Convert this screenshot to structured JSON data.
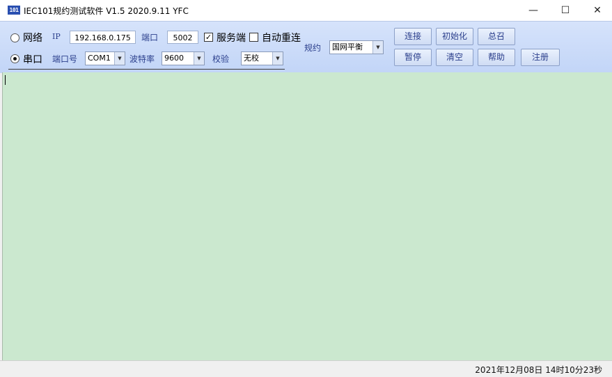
{
  "window": {
    "title": "IEC101规约测试软件  V1.5 2020.9.11   YFC",
    "icon_text": "101",
    "minimize": "—",
    "maximize": "☐",
    "close": "✕"
  },
  "network": {
    "radio_label": "网络",
    "ip_label": "IP",
    "ip_value": "192.168.0.175",
    "port_label": "端口",
    "port_value": "5002",
    "server_checked": true,
    "server_label": "服务端",
    "reconnect_checked": false,
    "reconnect_label": "自动重连"
  },
  "serial": {
    "radio_label": "串口",
    "com_label": "端口号",
    "com_value": "COM1",
    "baud_label": "波特率",
    "baud_value": "9600",
    "parity_label": "校验",
    "parity_value": "无校"
  },
  "protocol": {
    "label": "规约",
    "value": "国网平衡"
  },
  "buttons": {
    "connect": "连接",
    "init": "初始化",
    "general_call": "总召",
    "pause": "暂停",
    "clear": "清空",
    "help": "帮助",
    "register": "注册"
  },
  "status": {
    "datetime": "2021年12月08日   14时10分23秒"
  },
  "selected_mode": "serial",
  "colors": {
    "toolbar": "#c8daf8",
    "log_area": "#cbe8cf",
    "button_text": "#2b3f8c"
  }
}
